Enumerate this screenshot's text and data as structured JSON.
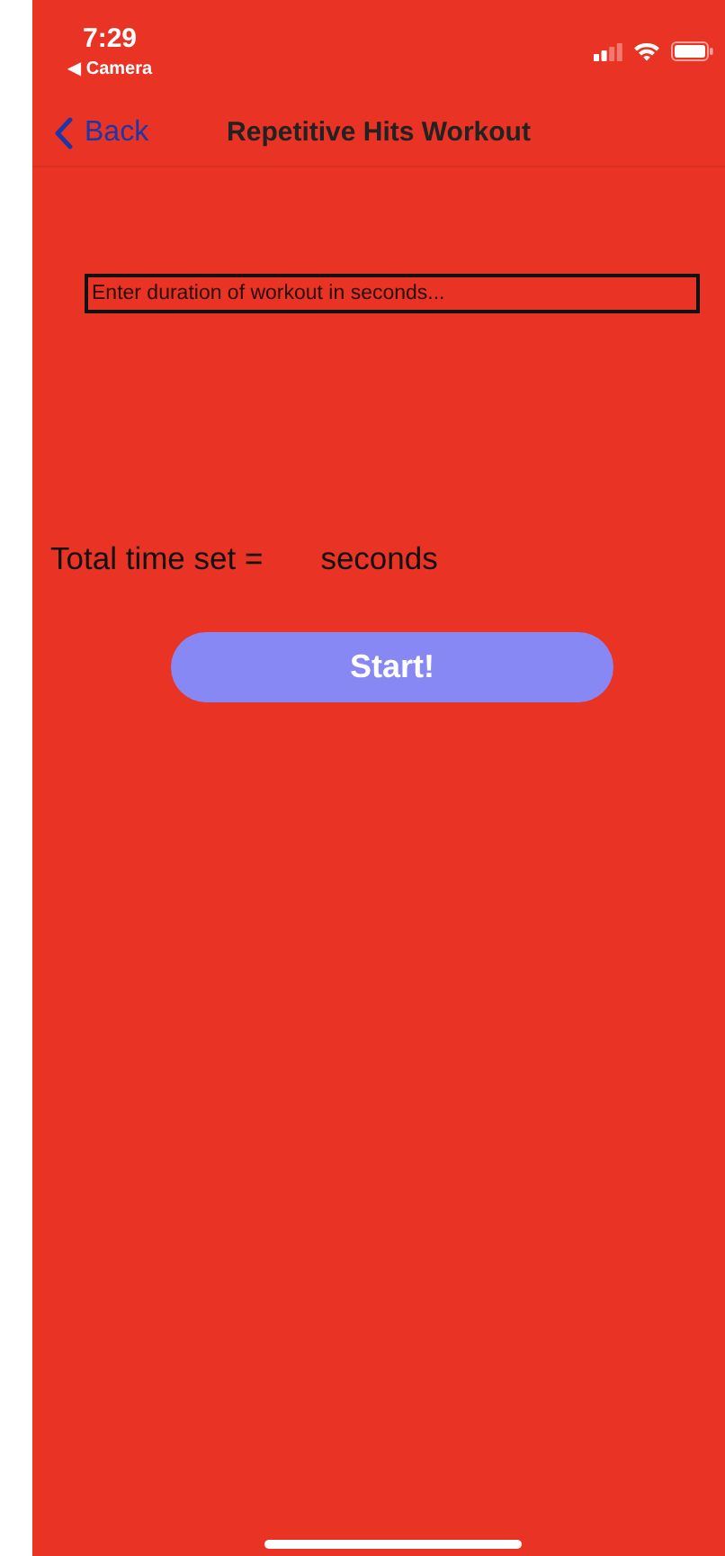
{
  "status_bar": {
    "time": "7:29",
    "back_app": "◀ Camera"
  },
  "nav_bar": {
    "back": "Back",
    "title": "Repetitive Hits Workout"
  },
  "duration_field": {
    "placeholder": "Enter duration of workout in seconds..."
  },
  "total": {
    "label": "Total time set =",
    "unit": "seconds"
  },
  "start_button": "Start!"
}
